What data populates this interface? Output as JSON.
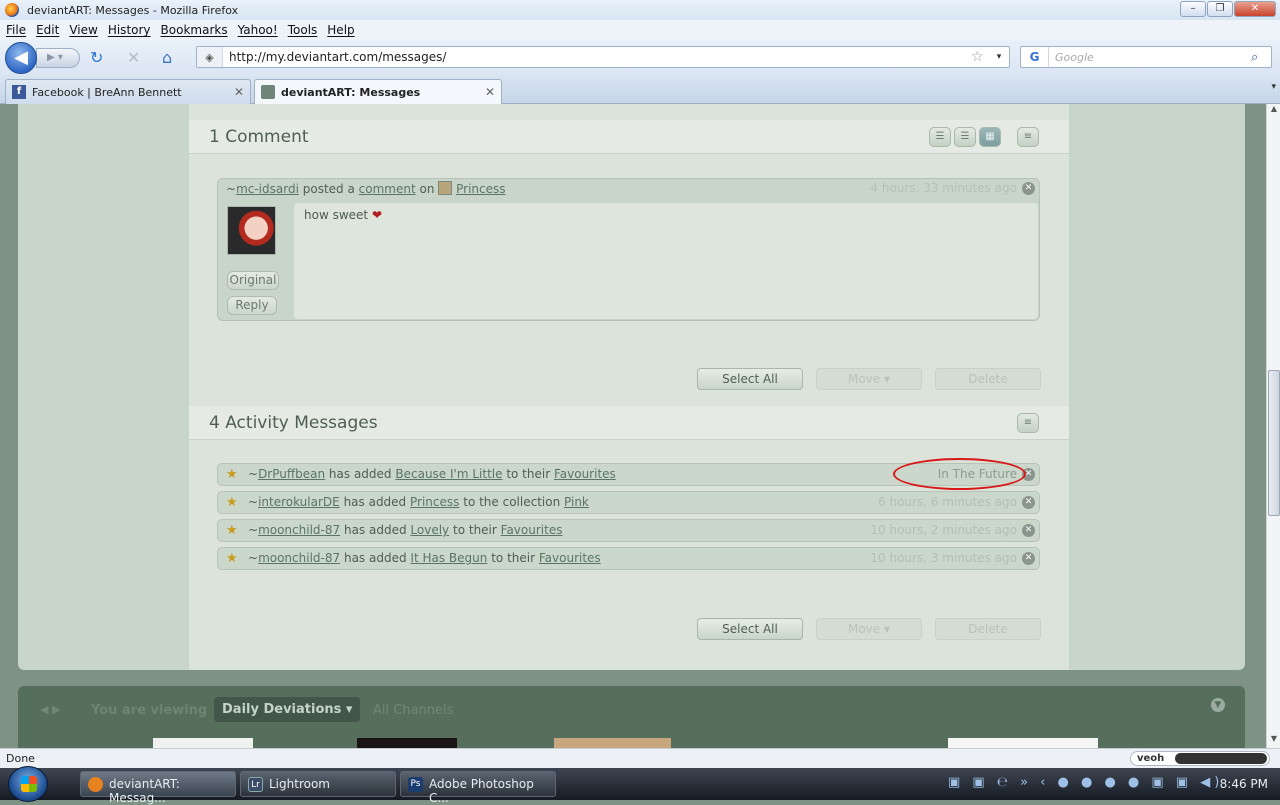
{
  "browser": {
    "title": "deviantART: Messages - Mozilla Firefox",
    "menu": [
      "File",
      "Edit",
      "View",
      "History",
      "Bookmarks",
      "Yahoo!",
      "Tools",
      "Help"
    ],
    "url": "http://my.deviantart.com/messages/",
    "search_placeholder": "Google",
    "tabs": [
      {
        "label": "Facebook | BreAnn Bennett",
        "active": false
      },
      {
        "label": "deviantART: Messages",
        "active": true
      }
    ],
    "status": "Done",
    "veoh": "veoh"
  },
  "comments": {
    "heading": "1 Comment",
    "item": {
      "prefix": "~",
      "user": "mc-idsardi",
      "action": "posted a",
      "link": "comment",
      "on": "on",
      "target": "Princess",
      "time": "4 hours, 33 minutes ago",
      "text": "how sweet",
      "original_label": "Original",
      "reply_label": "Reply"
    },
    "select_all": "Select All",
    "move": "Move ▾",
    "delete": "Delete"
  },
  "activity": {
    "heading": "4 Activity Messages",
    "rows": [
      {
        "user": "DrPuffbean",
        "verb": "has added",
        "item": "Because I'm Little",
        "mid": "to their",
        "dest": "Favourites",
        "time": "In The Future"
      },
      {
        "user": "interokularDE",
        "verb": "has added",
        "item": "Princess",
        "mid": "to the collection",
        "dest": "Pink",
        "time": "6 hours, 6 minutes ago"
      },
      {
        "user": "moonchild-87",
        "verb": "has added",
        "item": "Lovely",
        "mid": "to their",
        "dest": "Favourites",
        "time": "10 hours, 2 minutes ago"
      },
      {
        "user": "moonchild-87",
        "verb": "has added",
        "item": "It Has Begun",
        "mid": "to their",
        "dest": "Favourites",
        "time": "10 hours, 3 minutes ago"
      }
    ],
    "select_all": "Select All",
    "move": "Move ▾",
    "delete": "Delete"
  },
  "channel_bar": {
    "viewing_label": "You are viewing",
    "selected": "Daily Deviations ▾",
    "all": "All Channels"
  },
  "taskbar": {
    "items": [
      {
        "label": "deviantART: Messag...",
        "icon": "firefox-icon"
      },
      {
        "label": "Lightroom",
        "icon": "lightroom-icon"
      },
      {
        "label": "Adobe Photoshop C...",
        "icon": "photoshop-icon"
      }
    ],
    "clock": "8:46 PM"
  }
}
